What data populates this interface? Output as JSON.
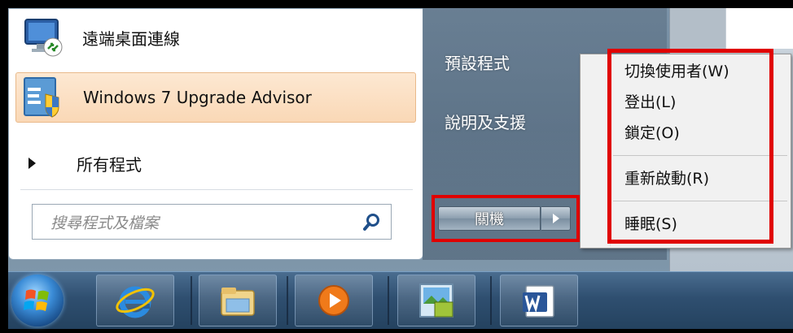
{
  "start_menu": {
    "programs": [
      {
        "label": "遠端桌面連線",
        "icon": "remote-desktop-icon"
      },
      {
        "label": "Windows 7 Upgrade Advisor",
        "icon": "upgrade-advisor-icon"
      }
    ],
    "all_programs_label": "所有程式",
    "search": {
      "placeholder": "搜尋程式及檔案",
      "icon": "search-icon"
    },
    "right_links": [
      "預設程式",
      "說明及支援"
    ],
    "shutdown": {
      "label": "關機",
      "arrow_icon": "chevron-right-icon"
    }
  },
  "shutdown_submenu": {
    "items": [
      "切換使用者(W)",
      "登出(L)",
      "鎖定(O)",
      "重新啟動(R)",
      "睡眠(S)"
    ]
  },
  "taskbar": {
    "items": [
      "start-orb",
      "internet-explorer-icon",
      "windows-explorer-icon",
      "media-player-icon",
      "photo-app-icon",
      "word-icon"
    ]
  },
  "colors": {
    "highlight_red": "#e00000",
    "hover_orange": "#fad8b6",
    "taskbar_blue": "#2f4f70"
  }
}
